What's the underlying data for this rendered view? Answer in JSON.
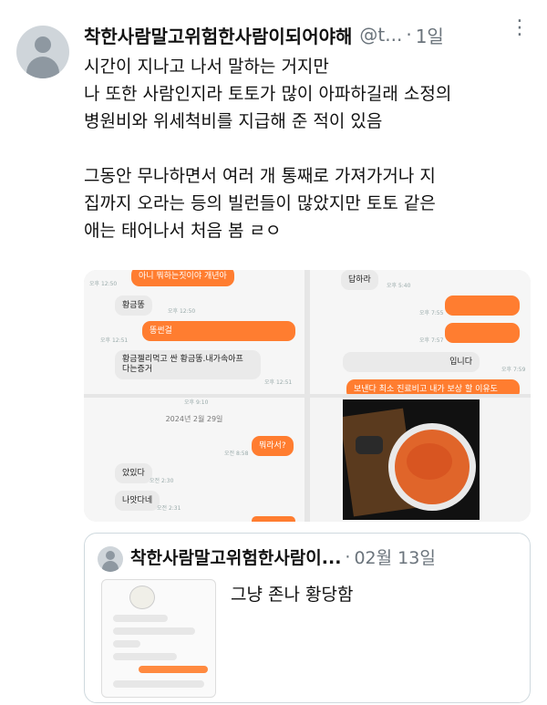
{
  "tweet": {
    "display_name": "착한사람말고위험한사람이되어야해",
    "handle": "@t...",
    "separator": "·",
    "time": "1일",
    "more_icon": "more-vertical-icon",
    "lines": [
      "시간이 지나고 나서 말하는 거지만",
      "나 또한 사람인지라 토토가 많이 아파하길래 소정의",
      "병원비와 위세척비를 지급해 준 적이 있음",
      "",
      "그동안 무나하면서 여러 개 통째로 가져가거나 지",
      "집까지 오라는 등의 빌런들이 많았지만 토토 같은",
      "애는 태어나서 처음 봄 ㄹㅇ"
    ]
  },
  "media": {
    "panel1": {
      "msg_top": "아니 뭐하는짓이야 개년아",
      "t0": "오후 12:50",
      "msg_a": "황금똥",
      "t1": "오후 12:50",
      "msg_b": "똥썬걸",
      "t2": "오후 12:51",
      "msg_c1": "황금젤리먹고 싼 황금똥.내가속아프",
      "msg_c2": "다는증거",
      "t3": "오후 12:51"
    },
    "panel2": {
      "msg_top": "답하라",
      "t0": "오후 5:40",
      "t1": "오후 7:55",
      "t2": "오후 7:57",
      "msg_d": "입니다",
      "t3": "오후 7:59",
      "msg_e": "보낸다 최소 진료비고 내가 보상 할 이유도"
    },
    "panel3": {
      "t_top": "오후 9:10",
      "date": "2024년 2월 29일",
      "msg_f": "뭐라서?",
      "t1": "오전 8:58",
      "msg_g": "았있다",
      "t2": "오전 2:30",
      "msg_h": "나앗다네",
      "t3": "오전 2:31"
    }
  },
  "quote": {
    "display_name": "착한사람말고위험한사람이...",
    "separator": "·",
    "time": "02월 13일",
    "text": "그냥 존나 황당함"
  },
  "colors": {
    "accent_orange": "#ff7d30",
    "muted_text": "#6b747c",
    "border": "#cfd9de"
  }
}
